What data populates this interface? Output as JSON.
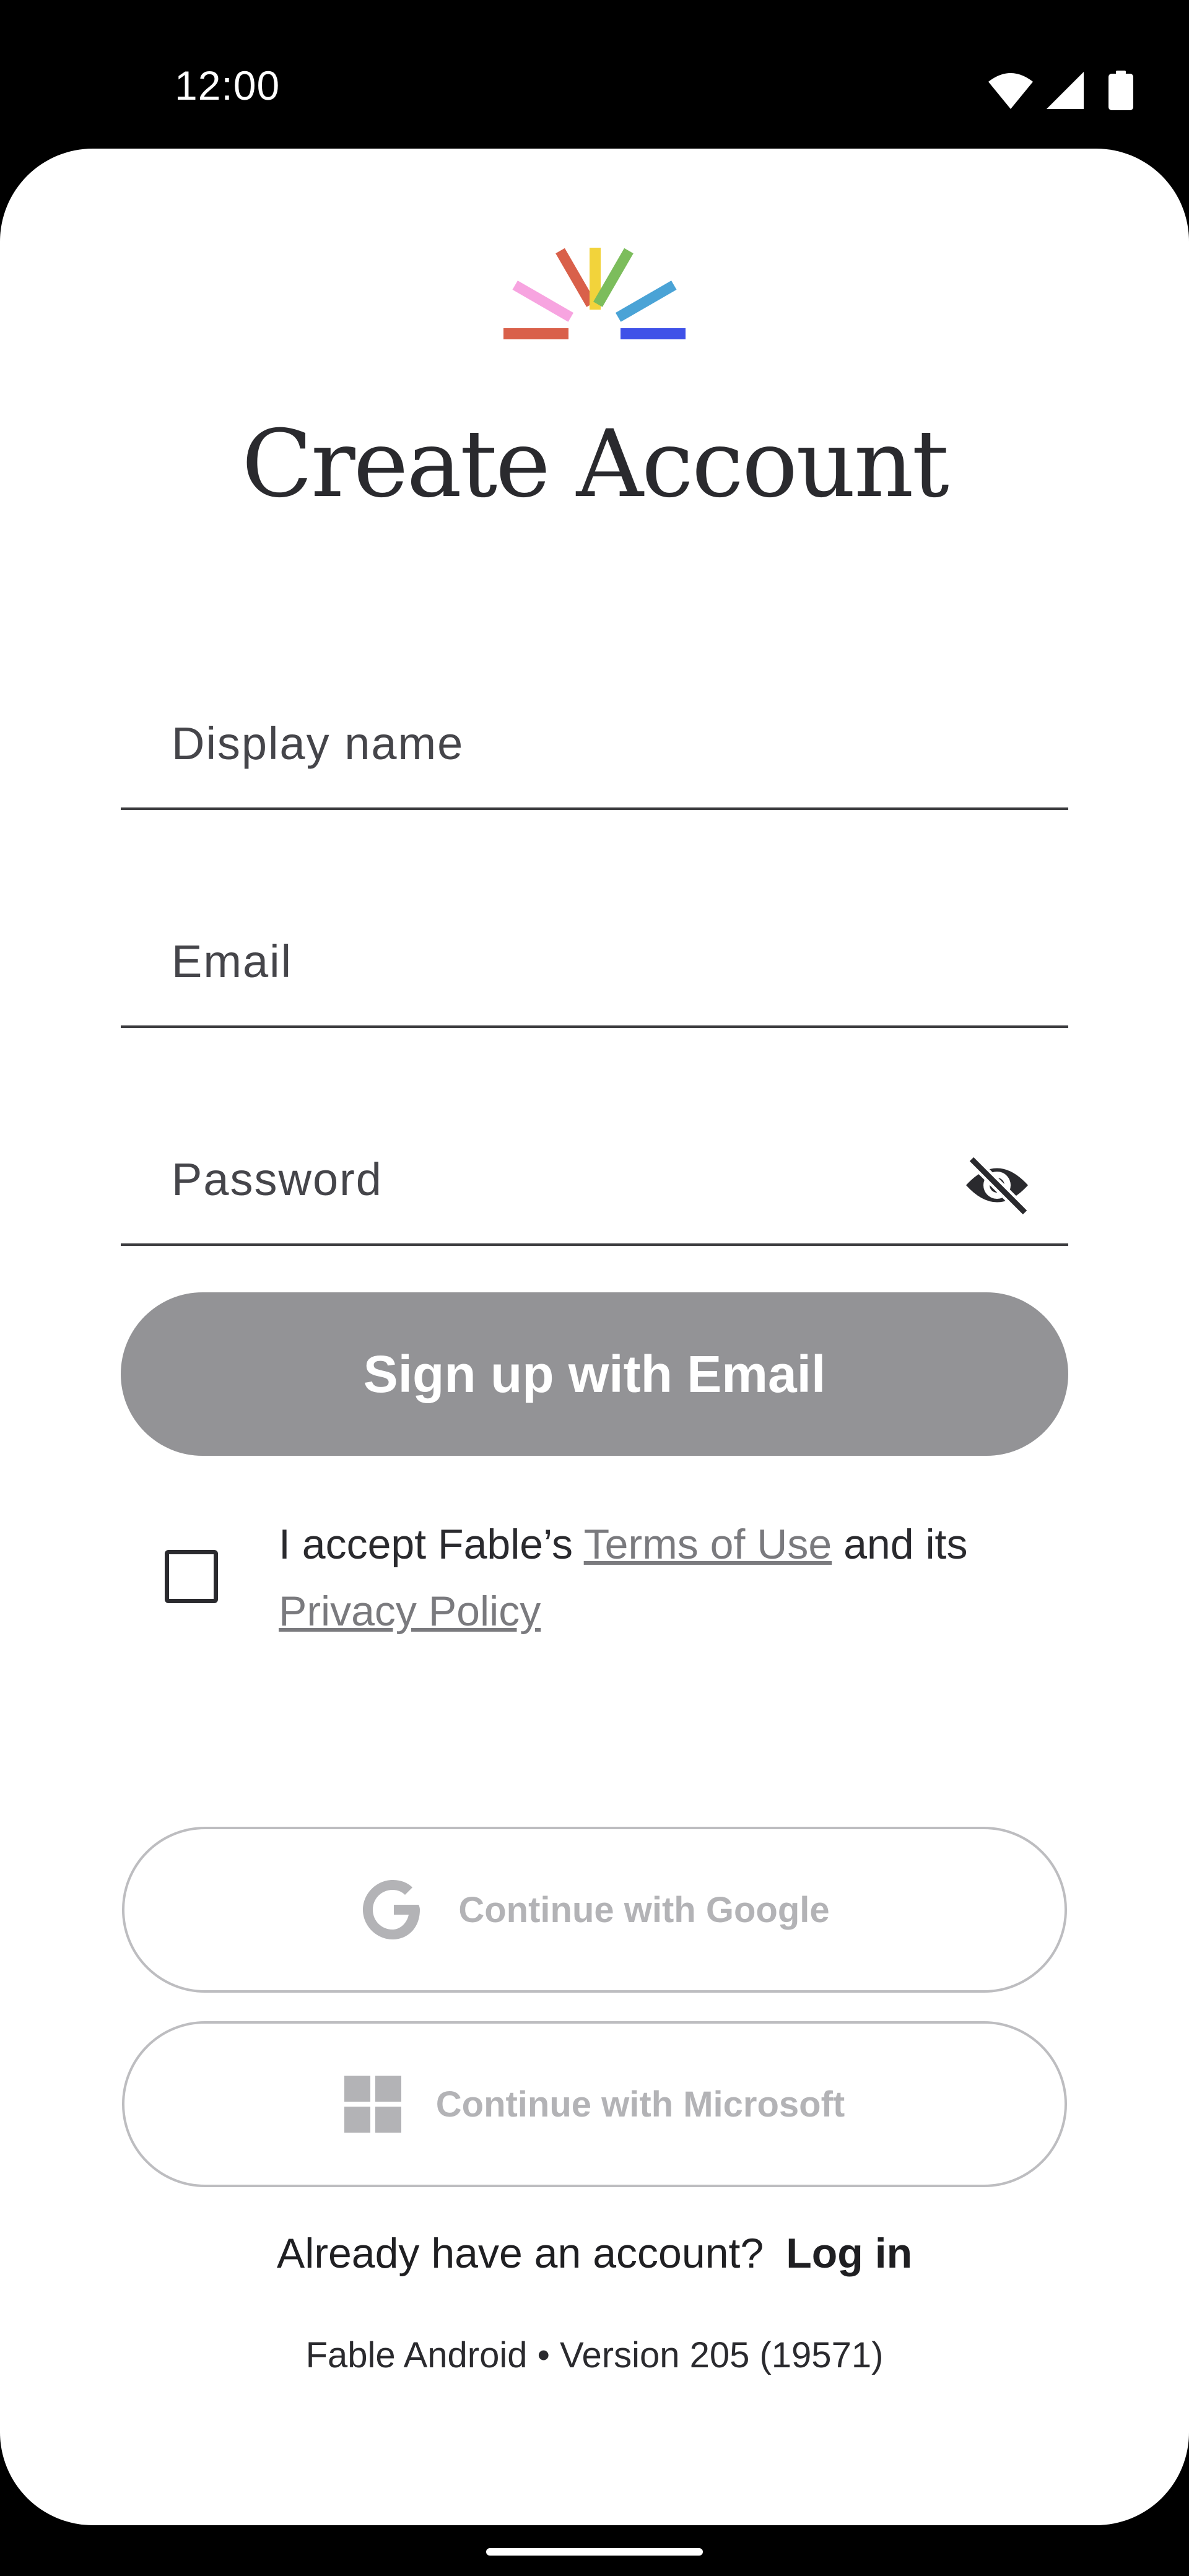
{
  "status_bar": {
    "time": "12:00",
    "icons": [
      "wifi-icon",
      "signal-icon",
      "battery-icon"
    ]
  },
  "header": {
    "logo_icon": "fable-rainbow-logo",
    "title": "Create Account"
  },
  "form": {
    "display_name": {
      "value": "",
      "placeholder": "Display name"
    },
    "email": {
      "value": "",
      "placeholder": "Email"
    },
    "password": {
      "value": "",
      "placeholder": "Password",
      "toggle_icon": "eye-off-icon"
    },
    "submit_label": "Sign up with Email"
  },
  "terms": {
    "checked": false,
    "prefix": "I accept Fable’s ",
    "terms_link": "Terms of Use",
    "middle": " and its ",
    "privacy_link": "Privacy Policy"
  },
  "social": {
    "google_label": "Continue with Google",
    "microsoft_label": "Continue with Microsoft"
  },
  "footer": {
    "login_prompt": "Already have an account?",
    "login_link": "Log in",
    "version": "Fable Android • Version 205 (19571)"
  },
  "colors": {
    "primary_disabled": "#939396",
    "text_dark": "#2a2a2e",
    "link_grey": "#7a7a7e",
    "logo_red": "#d9604a",
    "logo_pink": "#f7a4e0",
    "logo_orange": "#d9604a",
    "logo_yellow": "#f2d33b",
    "logo_green": "#7cbd5c",
    "logo_blue": "#4aa3d6",
    "logo_indigo": "#3f51e8"
  }
}
